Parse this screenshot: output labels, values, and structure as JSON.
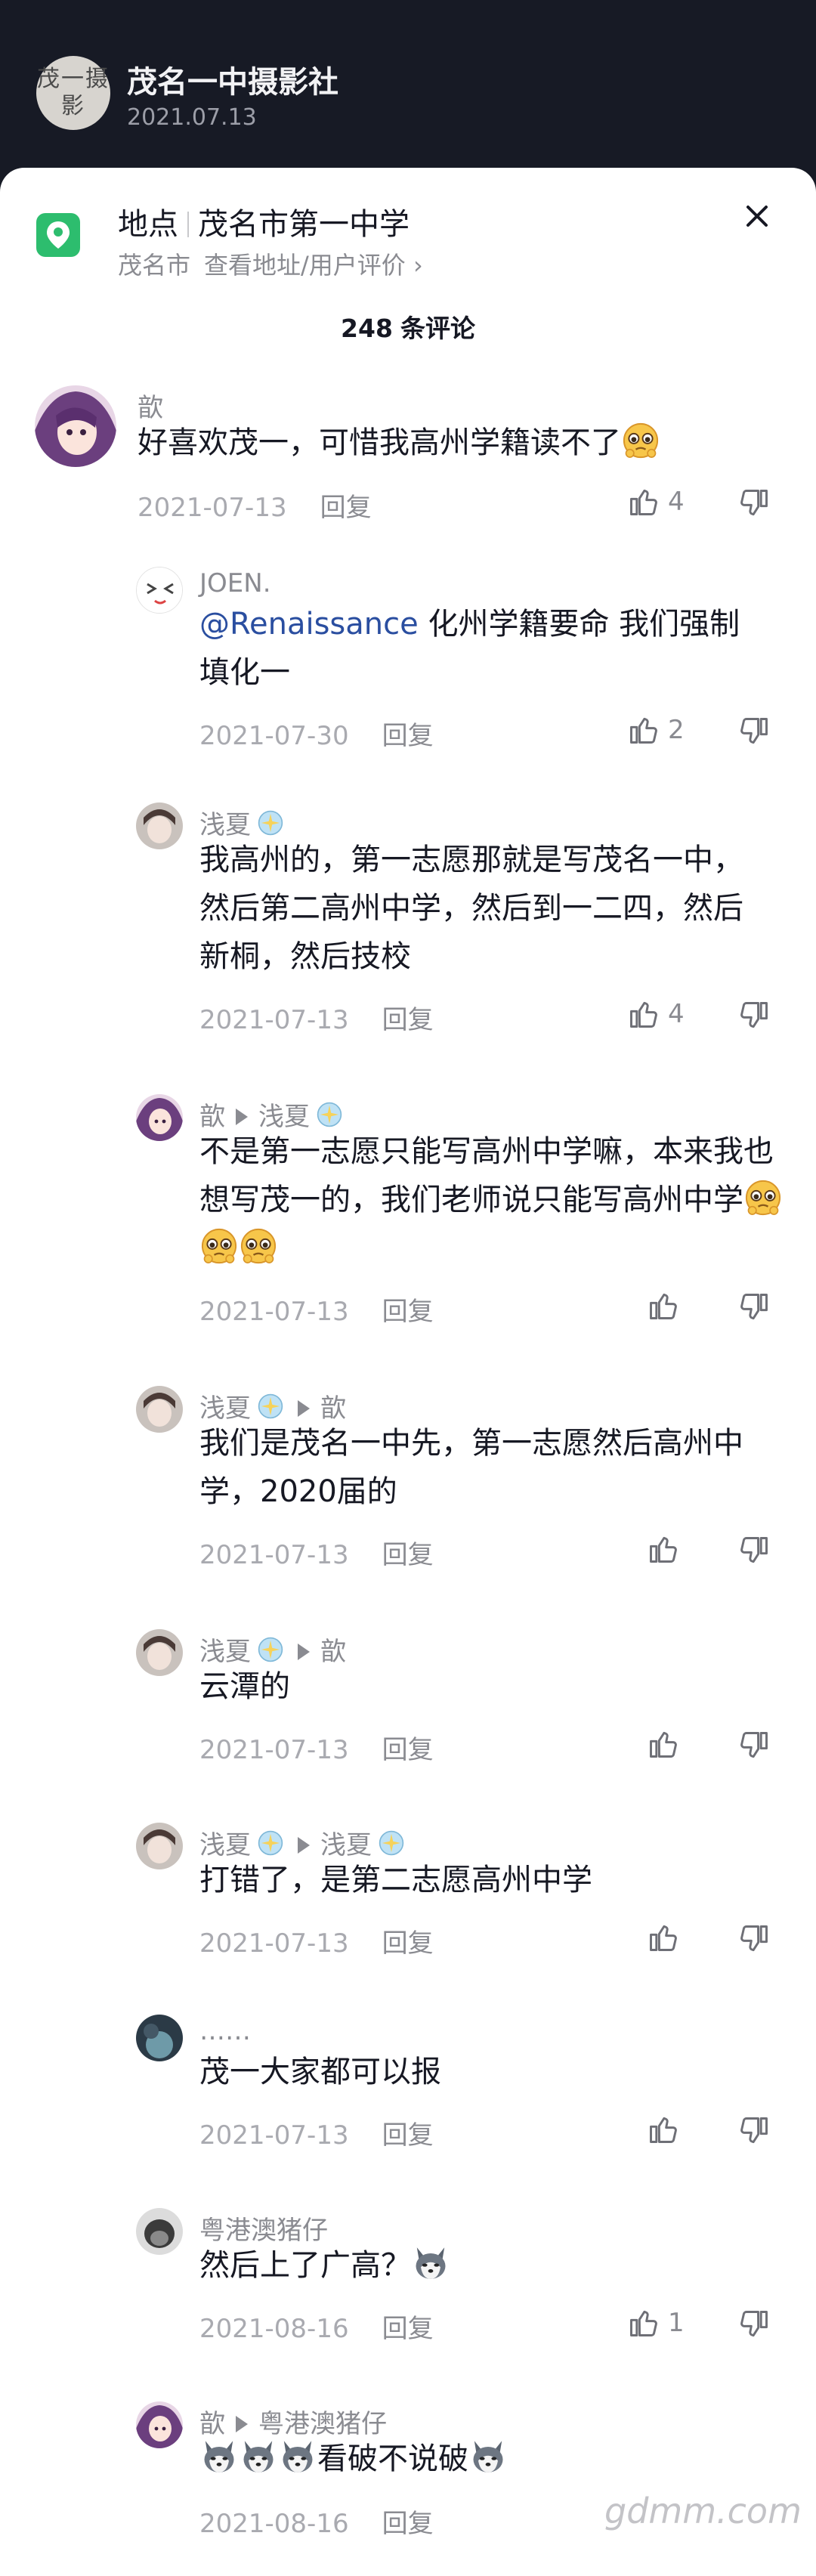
{
  "header": {
    "avatar_text": "茂一摄影",
    "title": "茂名一中摄影社",
    "date": "2021.07.13"
  },
  "location": {
    "label": "地点",
    "place": "茂名市第一中学",
    "city": "茂名市",
    "link": "查看地址/用户评价 ›"
  },
  "comments_count": {
    "number": "248",
    "label": "条评论"
  },
  "comments": [
    {
      "author": "歆",
      "text": "好喜欢茂一，可惜我高州学籍读不了",
      "date": "2021-07-13",
      "reply": "回复",
      "likes": "4"
    },
    {
      "author": "JOEN.",
      "mention": "@Renaissance",
      "text": " 化州学籍要命 我们强制填化一",
      "date": "2021-07-30",
      "reply": "回复",
      "likes": "2"
    },
    {
      "author": "浅夏",
      "text": "我高州的，第一志愿那就是写茂名一中，然后第二高州中学，然后到一二四，然后新桐，然后技校",
      "date": "2021-07-13",
      "reply": "回复",
      "likes": "4"
    },
    {
      "author": "歆",
      "reply_to": "浅夏",
      "text": "不是第一志愿只能写高州中学嘛，本来我也想写茂一的，我们老师说只能写高州中学",
      "date": "2021-07-13",
      "reply": "回复"
    },
    {
      "author": "浅夏",
      "reply_to": "歆",
      "text": "我们是茂名一中先，第一志愿然后高州中学，2020届的",
      "date": "2021-07-13",
      "reply": "回复"
    },
    {
      "author": "浅夏",
      "reply_to": "歆",
      "text": "云潭的",
      "date": "2021-07-13",
      "reply": "回复"
    },
    {
      "author": "浅夏",
      "reply_to": "浅夏",
      "text": "打错了，是第二志愿高州中学",
      "date": "2021-07-13",
      "reply": "回复"
    },
    {
      "author": "……",
      "text": "茂一大家都可以报",
      "date": "2021-07-13",
      "reply": "回复"
    },
    {
      "author": "粤港澳猪仔",
      "text": "然后上了广高？",
      "date": "2021-08-16",
      "reply": "回复",
      "likes": "1"
    },
    {
      "author": "歆",
      "reply_to": "粤港澳猪仔",
      "text": "看破不说破",
      "date": "2021-08-16",
      "reply": "回复"
    }
  ],
  "watermark": "gdmm.com",
  "colors": {
    "header_bg": "#171a25",
    "location_green": "#2dbd6e",
    "mention_blue": "#2a4ea0"
  }
}
